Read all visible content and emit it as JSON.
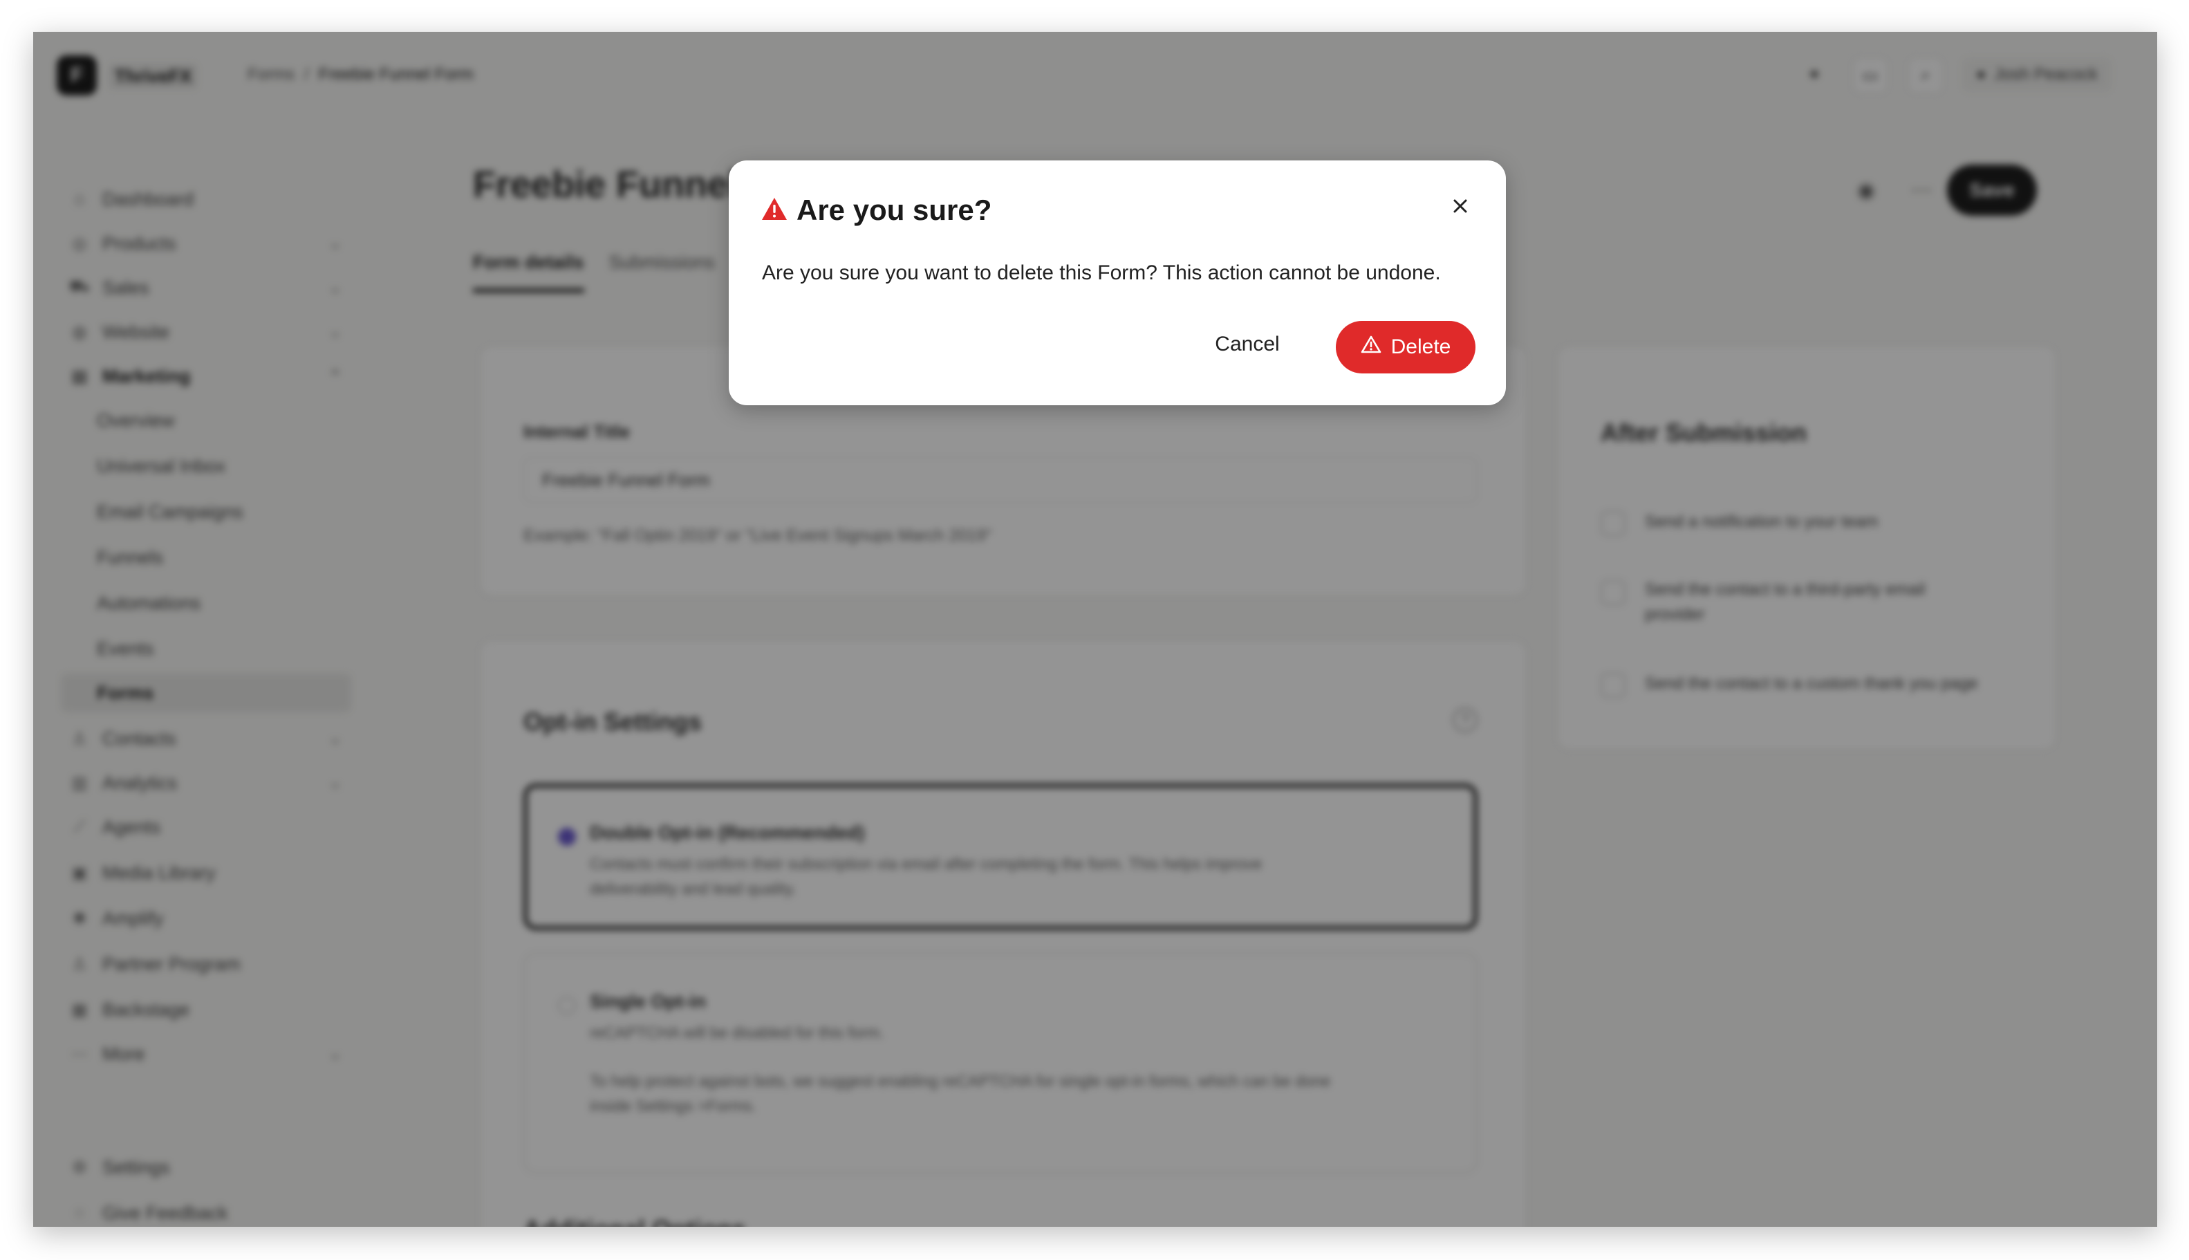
{
  "app": {
    "logo_letter": "F",
    "name": "ThriveFX"
  },
  "breadcrumb": {
    "parent": "Forms",
    "separator": "/",
    "current": "Freebie Funnel Form"
  },
  "header": {
    "user_name": "Josh Peacock"
  },
  "sidebar": {
    "items": [
      {
        "label": "Dashboard",
        "icon": "home-icon"
      },
      {
        "label": "Products",
        "icon": "box-icon",
        "chevron": "⌄"
      },
      {
        "label": "Sales",
        "icon": "cart-icon",
        "chevron": "⌄"
      },
      {
        "label": "Website",
        "icon": "globe-icon",
        "chevron": "⌄"
      },
      {
        "label": "Marketing",
        "icon": "megaphone-icon",
        "chevron": "⌃"
      },
      {
        "label": "Overview"
      },
      {
        "label": "Universal Inbox"
      },
      {
        "label": "Email Campaigns"
      },
      {
        "label": "Funnels"
      },
      {
        "label": "Automations"
      },
      {
        "label": "Events"
      },
      {
        "label": "Forms"
      },
      {
        "label": "Contacts",
        "icon": "user-icon",
        "chevron": "⌄"
      },
      {
        "label": "Analytics",
        "icon": "chart-icon",
        "chevron": "⌄"
      },
      {
        "label": "Agents",
        "icon": "wand-icon"
      },
      {
        "label": "Media Library",
        "icon": "image-icon"
      },
      {
        "label": "Amplify",
        "icon": "bolt-icon"
      },
      {
        "label": "Partner Program",
        "icon": "people-icon"
      },
      {
        "label": "Backstage",
        "icon": "building-icon"
      },
      {
        "label": "More",
        "icon": "dots-icon",
        "chevron": "⌄"
      }
    ],
    "footer": {
      "settings": "Settings",
      "feedback": "Give Feedback"
    }
  },
  "page": {
    "title": "Freebie Funnel Form",
    "tabs": [
      "Form details",
      "Submissions"
    ],
    "save_label": "Save"
  },
  "details_card": {
    "label": "Internal Title",
    "value": "Freebie Funnel Form",
    "hint": "Example: \"Fall Optin 2019\" or \"Live Event Signups March 2019\""
  },
  "optin": {
    "title": "Opt-in Settings",
    "double": {
      "title": "Double Opt-in (Recommended)",
      "desc_1": "Contacts must confirm their subscription via email after completing the form. This helps improve",
      "desc_2": "deliverability and lead quality."
    },
    "single": {
      "title": "Single Opt-in",
      "desc": "reCAPTCHA will be disabled for this form.",
      "desc_2": "To help protect against bots, we suggest enabling reCAPTCHA for single opt-in forms, which can be done",
      "desc_3": "inside Settings >Forms."
    }
  },
  "additional_options": {
    "title": "Additional Options"
  },
  "after_submission": {
    "title": "After Submission",
    "opt_1": "Send a notification to your team",
    "opt_2a": "Send the contact to a third-party email",
    "opt_2b": "provider",
    "opt_3": "Send the contact to a custom thank you page"
  },
  "dialog": {
    "title": "Are you sure?",
    "message": "Are you sure you want to delete this Form? This action cannot be undone.",
    "cancel_label": "Cancel",
    "delete_label": "Delete",
    "danger_color": "#e02a2a"
  }
}
